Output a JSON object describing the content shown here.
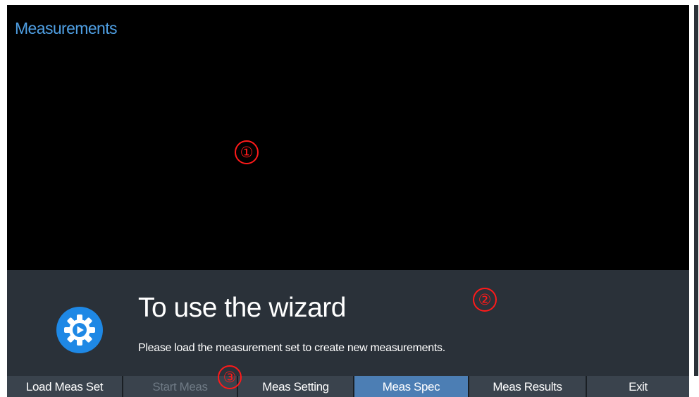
{
  "main": {
    "title": "Measurements"
  },
  "markers": [
    "①",
    "②",
    "③"
  ],
  "wizard": {
    "icon": "play-gear-icon",
    "title": "To use the wizard",
    "text": "Please load the measurement set to create new measurements."
  },
  "softkeys": [
    {
      "label": "Load Meas Set",
      "state": "normal"
    },
    {
      "label": "Start Meas",
      "state": "disabled"
    },
    {
      "label": "Meas Setting",
      "state": "normal"
    },
    {
      "label": "Meas Spec",
      "state": "active"
    },
    {
      "label": "Meas Results",
      "state": "normal"
    },
    {
      "label": "Exit",
      "state": "normal"
    }
  ],
  "colors": {
    "title_blue": "#4f9fe3",
    "panel_bg": "#2a3139",
    "softkey_bg": "#3a434d",
    "softkey_active": "#4c7eb4",
    "marker_red": "#ff1a1a",
    "icon_blue": "#1e88e5"
  }
}
